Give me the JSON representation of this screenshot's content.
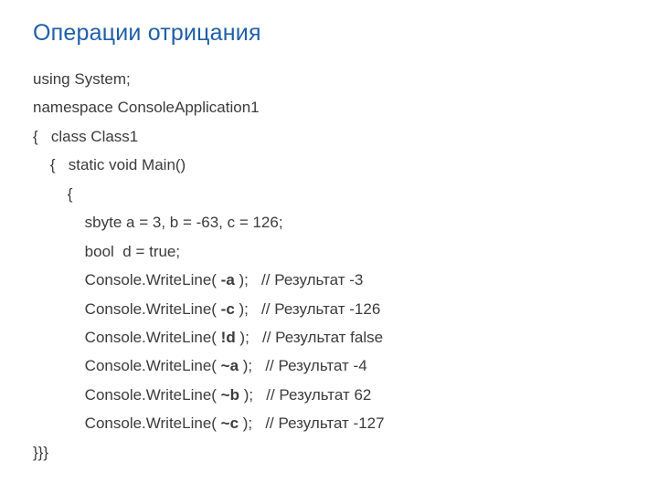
{
  "title": "Операции отрицания",
  "lines": {
    "l0": "using System;",
    "l1": "namespace ConsoleApplication1",
    "l2": "{   class Class1",
    "l3": "    {   static void Main()",
    "l4": "        {",
    "l5": "            sbyte a = 3, b = -63, c = 126;",
    "l6": "            bool  d = true;",
    "l7a": "            Console.WriteLine( ",
    "l7b": "-a",
    "l7c": " );   // Результат -3",
    "l8a": "            Console.WriteLine( ",
    "l8b": "-c",
    "l8c": " );   // Результат -126",
    "l9a": "            Console.WriteLine( ",
    "l9b": "!d",
    "l9c": " );   // Результат false",
    "l10a": "            Console.WriteLine( ",
    "l10b": "~a",
    "l10c": " );   // Результат -4",
    "l11a": "            Console.WriteLine( ",
    "l11b": "~b",
    "l11c": " );   // Результат 62",
    "l12a": "            Console.WriteLine( ",
    "l12b": "~c",
    "l12c": " );   // Результат -127",
    "l13": "}}}"
  }
}
